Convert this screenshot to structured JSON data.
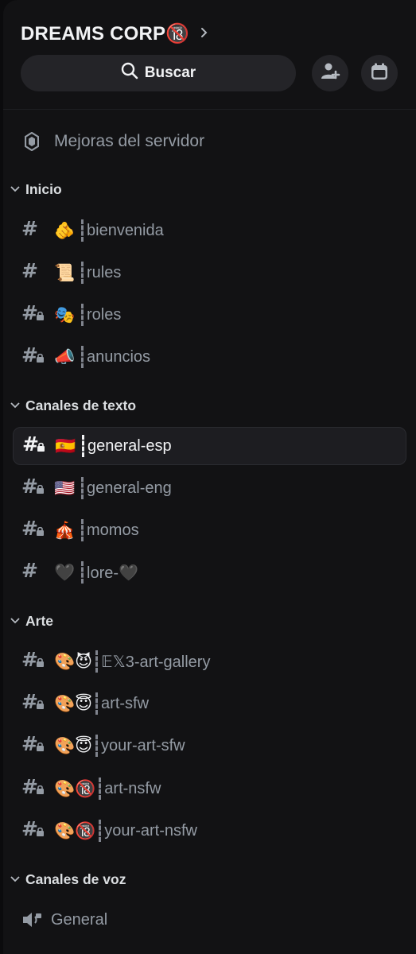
{
  "server": {
    "name": "DREAMS CORP",
    "name_badge": "🔞"
  },
  "toolbar": {
    "search_label": "Buscar"
  },
  "boosts": {
    "label": "Mejoras del servidor"
  },
  "categories": [
    {
      "label": "Inicio"
    },
    {
      "label": "Canales de texto"
    },
    {
      "label": "Arte"
    },
    {
      "label": "Canales de voz"
    }
  ],
  "channels": [
    {
      "emoji": "🫵",
      "label": "bienvenida",
      "locked": false
    },
    {
      "emoji": "📜",
      "label": "rules",
      "locked": false
    },
    {
      "emoji": "🎭",
      "label": "roles",
      "locked": true
    },
    {
      "emoji": "📣",
      "label": "anuncios",
      "locked": true
    },
    {
      "emoji": "🇪🇸",
      "label": "general-esp",
      "locked": true,
      "selected": true
    },
    {
      "emoji": "🇺🇸",
      "label": "general-eng",
      "locked": true
    },
    {
      "emoji": "🎪",
      "label": "momos",
      "locked": true
    },
    {
      "emoji": "🖤",
      "label": "lore-🖤",
      "locked": false
    },
    {
      "emoji": "🎨😈",
      "label": "𝔼𝕏3-art-gallery",
      "locked": true
    },
    {
      "emoji": "🎨😇",
      "label": "art-sfw",
      "locked": true
    },
    {
      "emoji": "🎨😇",
      "label": "your-art-sfw",
      "locked": true
    },
    {
      "emoji": "🎨🔞",
      "label": "art-nsfw",
      "locked": true
    },
    {
      "emoji": "🎨🔞",
      "label": "your-art-nsfw",
      "locked": true
    }
  ],
  "voice_channels": [
    {
      "label": "General"
    }
  ],
  "colors": {
    "background": "#121214",
    "muted_text": "#949ba4",
    "selected_bg": "#1d1d21",
    "pill": "#242428"
  }
}
